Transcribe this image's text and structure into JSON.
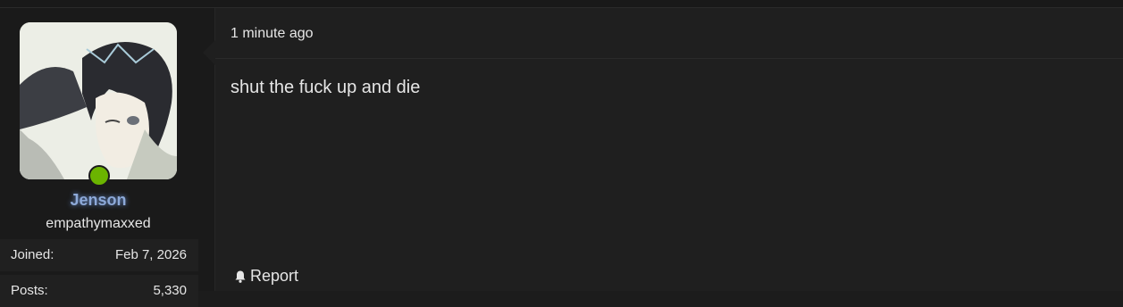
{
  "user": {
    "name": "Jenson",
    "title": "empathymaxxed",
    "online": true,
    "stats": [
      {
        "label": "Joined:",
        "value": "Feb 7, 2026"
      },
      {
        "label": "Posts:",
        "value": "5,330"
      }
    ]
  },
  "post": {
    "time": "1 minute ago",
    "content": "shut the fuck up and die",
    "report_label": "Report"
  },
  "colors": {
    "background": "#1c1c1c",
    "post_background": "#1f1f1f",
    "username": "#8da9d8",
    "online": "#6bb400"
  },
  "icons": {
    "report": "bell-icon",
    "status": "online-indicator"
  }
}
